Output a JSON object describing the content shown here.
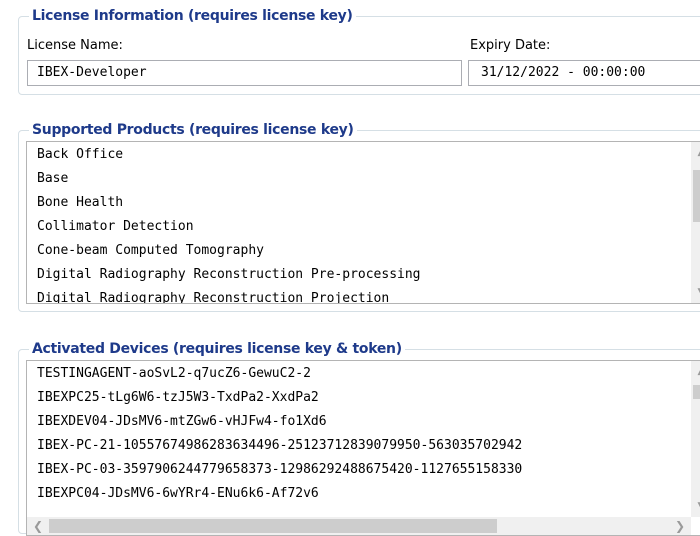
{
  "license_info": {
    "title": "License Information (requires license key)",
    "name_label": "License Name:",
    "name_value": "IBEX-Developer",
    "expiry_label": "Expiry Date:",
    "expiry_value": "31/12/2022 - 00:00:00"
  },
  "products": {
    "title": "Supported Products (requires license key)",
    "items": [
      "Back Office",
      "Base",
      "Bone Health",
      "Collimator Detection",
      "Cone-beam Computed Tomography",
      "Digital Radiography Reconstruction Pre-processing",
      "Digital Radiography Reconstruction Projection"
    ],
    "scroll_position_fraction": 0.2
  },
  "devices": {
    "title": "Activated Devices (requires license key & token)",
    "items": [
      "TESTINGAGENT-aoSvL2-q7ucZ6-GewuC2-2",
      "IBEXPC25-tLg6W6-tzJ5W3-TxdPa2-XxdPa2",
      "IBEXDEV04-JDsMV6-mtZGw6-vHJFw4-fo1Xd6",
      "IBEX-PC-21-10557674986283634496-25123712839079950-563035702942",
      "IBEX-PC-03-3597906244779658373-12986292488675420-1127655158330",
      "IBEXPC04-JDsMV6-6wYRr4-ENu6k6-Af72v6"
    ],
    "scroll_position_fraction": 0.1
  },
  "icons": {
    "scroll_up": "▲",
    "scroll_down": "▼",
    "scroll_left": "❮",
    "scroll_right": "❯"
  }
}
